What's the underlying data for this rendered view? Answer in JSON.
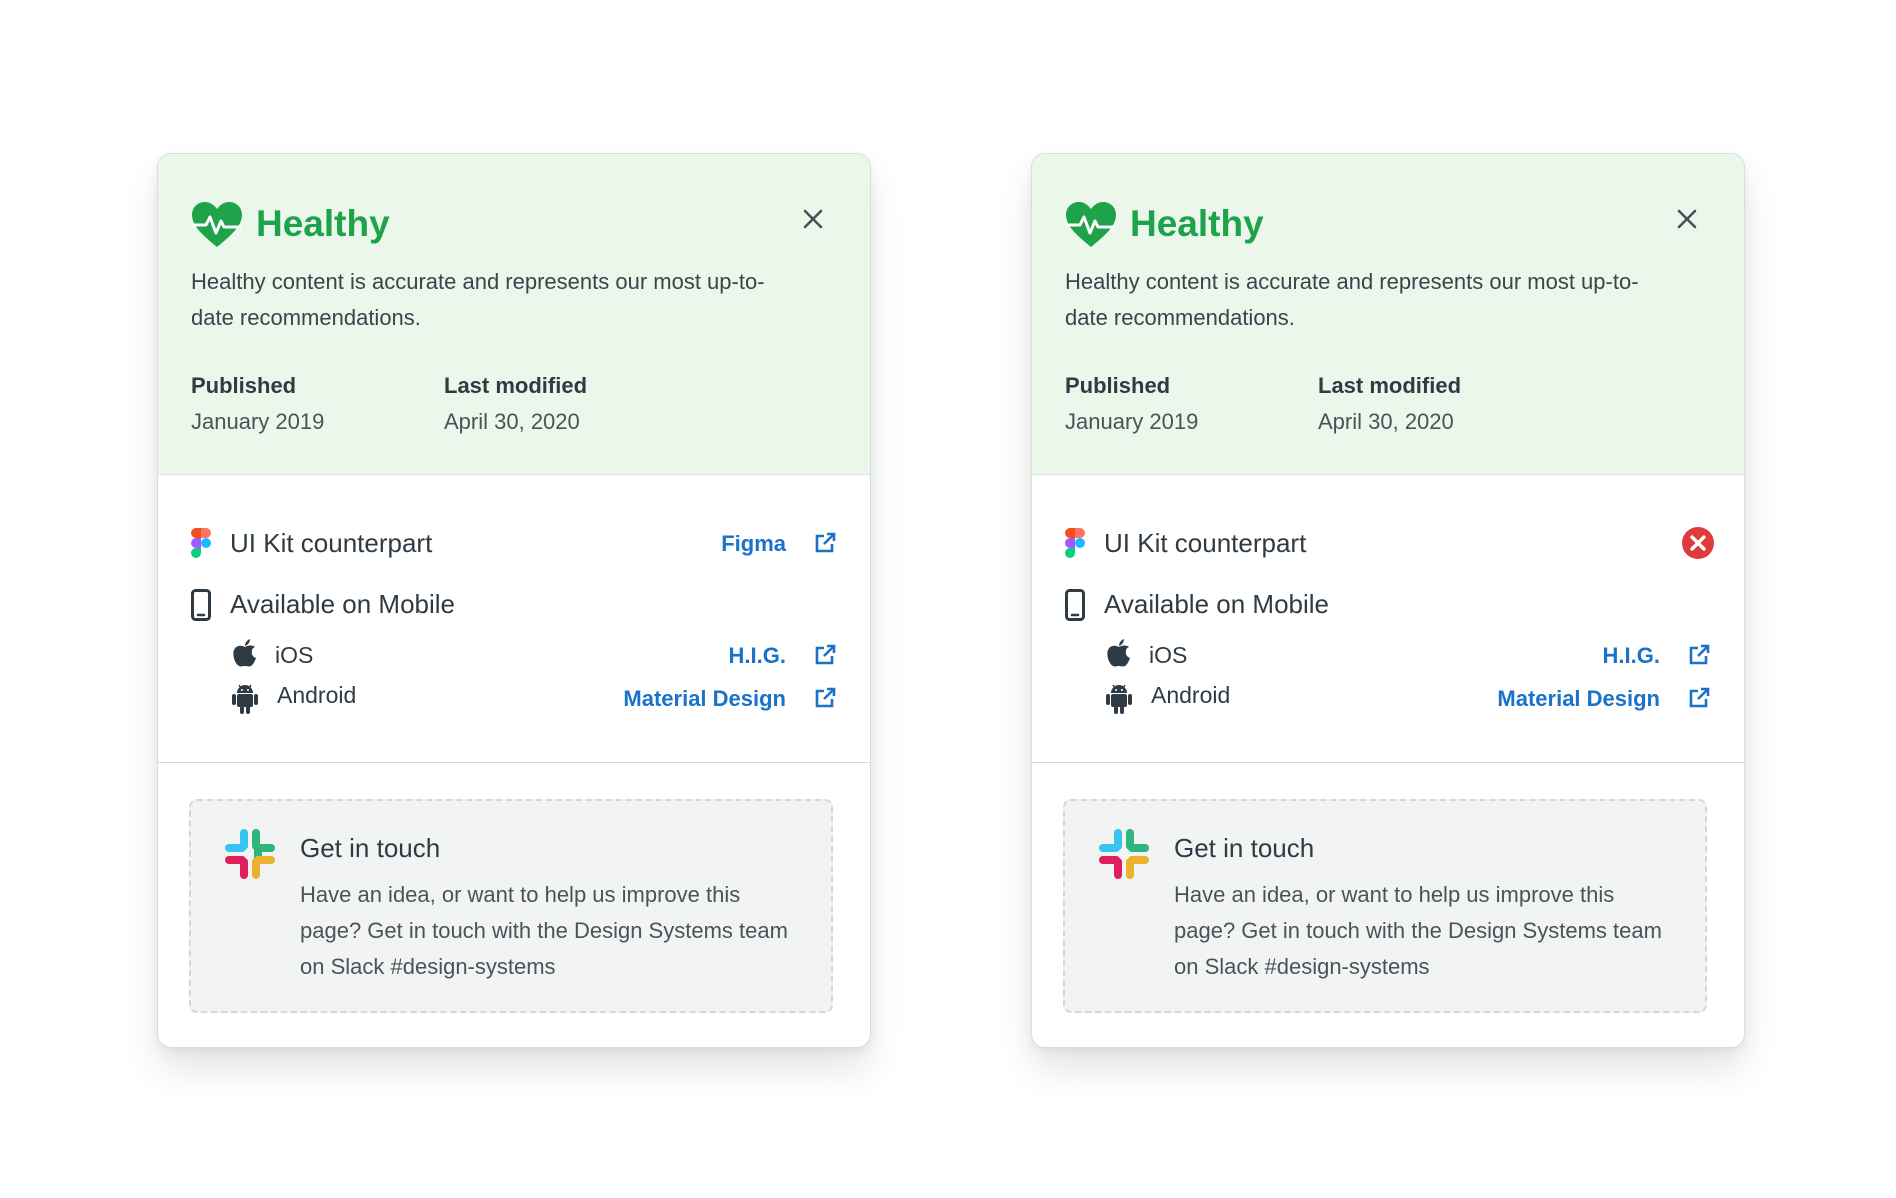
{
  "cards": [
    {
      "status_title": "Healthy",
      "status_description": "Healthy content is accurate and represents our most up-to-date recommendations.",
      "published_label": "Published",
      "published_value": "January 2019",
      "modified_label": "Last modified",
      "modified_value": "April 30, 2020",
      "ui_kit_label": "UI Kit counterpart",
      "ui_kit_link": "Figma",
      "mobile_label": "Available on Mobile",
      "ios_label": "iOS",
      "ios_link": "H.I.G.",
      "android_label": "Android",
      "android_link": "Material Design",
      "touch_title": "Get in touch",
      "touch_text": "Have an idea, or want to help us improve this page? Get in touch with the Design Systems team on Slack #design-systems"
    },
    {
      "status_title": "Healthy",
      "status_description": "Healthy content is accurate and represents our most up-to-date recommendations.",
      "published_label": "Published",
      "published_value": "January 2019",
      "modified_label": "Last modified",
      "modified_value": "April 30, 2020",
      "ui_kit_label": "UI Kit counterpart",
      "ui_kit_status_icon": "error-circle-icon",
      "mobile_label": "Available on Mobile",
      "ios_label": "iOS",
      "ios_link": "H.I.G.",
      "android_label": "Android",
      "android_link": "Material Design",
      "touch_title": "Get in touch",
      "touch_text": "Have an idea, or want to help us improve this page? Get in touch with the Design Systems team on Slack #design-systems"
    }
  ],
  "colors": {
    "healthy_green": "#1ea24a",
    "header_bg": "#eaf7ea",
    "link_blue": "#1a73c8",
    "error_red": "#e03a3a"
  }
}
